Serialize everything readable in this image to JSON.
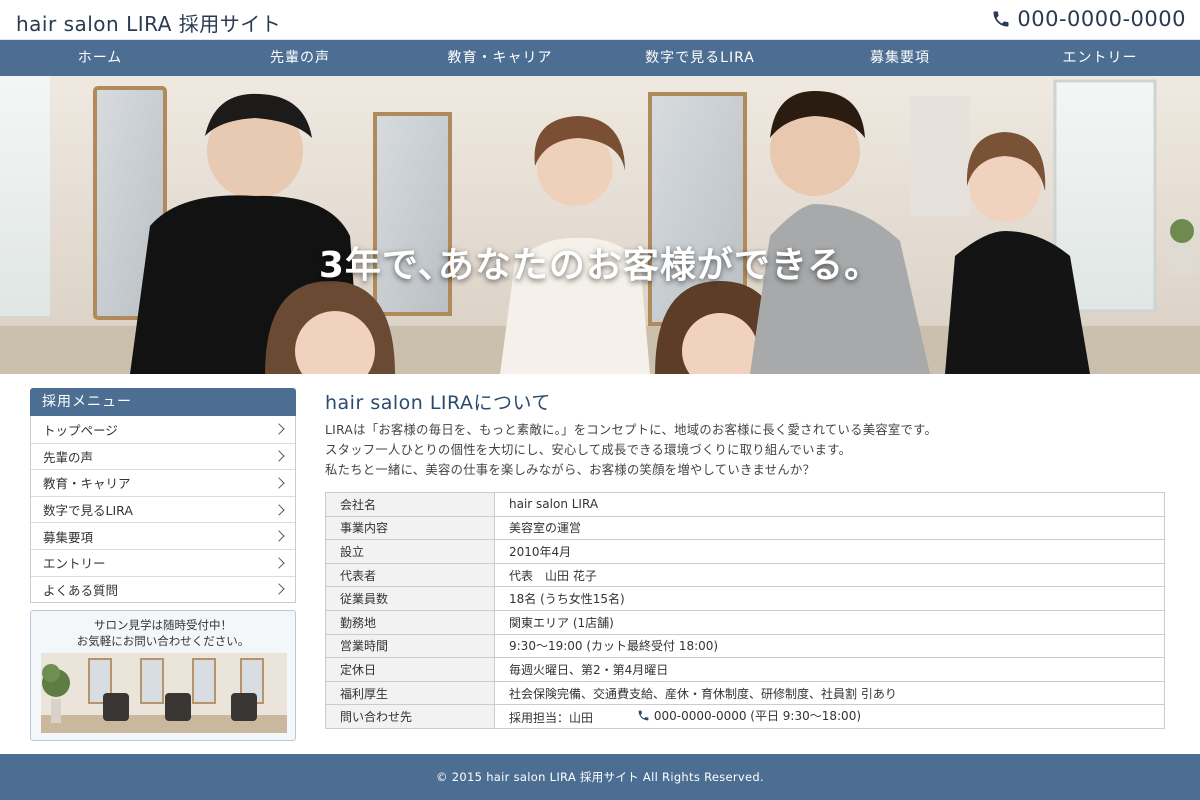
{
  "header": {
    "site_title": "hair salon LIRA 採用サイト",
    "phone": "000-0000-0000"
  },
  "nav": {
    "items": [
      {
        "label": "ホーム"
      },
      {
        "label": "先輩の声"
      },
      {
        "label": "教育・キャリア"
      },
      {
        "label": "数字で見るLIRA"
      },
      {
        "label": "募集要項"
      },
      {
        "label": "エントリー"
      }
    ]
  },
  "hero": {
    "caption": "3年で､あなたのお客様ができる。"
  },
  "sidebar": {
    "menu_title": "採用メニュー",
    "items": [
      {
        "label": "トップページ"
      },
      {
        "label": "先輩の声"
      },
      {
        "label": "教育・キャリア"
      },
      {
        "label": "数字で見るLIRA"
      },
      {
        "label": "募集要項"
      },
      {
        "label": "エントリー"
      },
      {
        "label": "よくある質問"
      }
    ],
    "visit_line1": "サロン見学は随時受付中！",
    "visit_line2": "お気軽にお問い合わせください。"
  },
  "main": {
    "title": "hair salon LIRAについて",
    "intro": [
      "LIRAは「お客様の毎日を、もっと素敵に。」をコンセプトに、地域のお客様に長く愛されている美容室です。",
      "スタッフ一人ひとりの個性を大切にし、安心して成長できる環境づくりに取り組んでいます。",
      "私たちと一緒に、美容の仕事を楽しみながら、お客様の笑顔を増やしていきませんか？"
    ],
    "rows": [
      {
        "key": "会社名",
        "value": "hair salon LIRA"
      },
      {
        "key": "事業内容",
        "value": "美容室の運営"
      },
      {
        "key": "設立",
        "value": "2010年4月"
      },
      {
        "key": "代表者",
        "value": "代表　山田 花子"
      },
      {
        "key": "従業員数",
        "value": "18名 (うち女性15名)"
      },
      {
        "key": "勤務地",
        "value": "関東エリア (1店舗)"
      },
      {
        "key": "営業時間",
        "value": "9:30〜19:00 (カット最終受付 18:00)"
      },
      {
        "key": "定休日",
        "value": "毎週火曜日、第2・第4月曜日"
      },
      {
        "key": "福利厚生",
        "value": "社会保険完備、交通費支給、産休・育休制度、研修制度、社員割 引あり"
      }
    ],
    "contact": {
      "key": "問い合わせ先",
      "person": "採用担当：山田",
      "phone": "000-0000-0000 (平日 9:30〜18:00)"
    }
  },
  "footer": {
    "copyright": "© 2015 hair salon LIRA 採用サイト All Rights Reserved."
  },
  "colors": {
    "brand": "#4c6e93",
    "title_text": "#2a4a70"
  },
  "icons": {
    "phone": "phone-icon",
    "chevron": "chevron-right-icon"
  }
}
